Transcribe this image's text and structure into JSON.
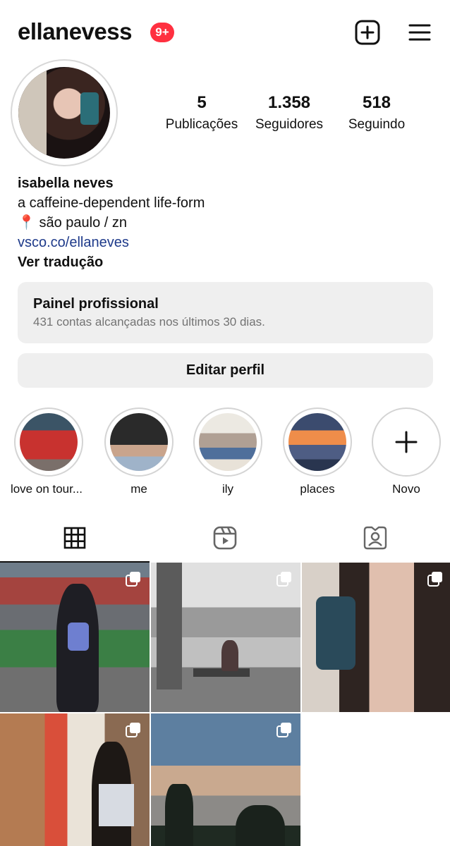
{
  "header": {
    "username": "ellanevess",
    "notification_badge": "9+",
    "icons": [
      "add-post-icon",
      "hamburger-menu-icon"
    ]
  },
  "profile": {
    "stats": [
      {
        "value": "5",
        "label": "Publicações"
      },
      {
        "value": "1.358",
        "label": "Seguidores"
      },
      {
        "value": "518",
        "label": "Seguindo"
      }
    ],
    "name": "isabella neves",
    "bio_line": "a caffeine-dependent life-form",
    "location_pin": "📍",
    "location": "são paulo / zn",
    "link": "vsco.co/ellaneves",
    "translate": "Ver tradução"
  },
  "professional_panel": {
    "title": "Painel profissional",
    "subtitle": "431 contas alcançadas nos últimos 30 dias."
  },
  "edit_profile_label": "Editar perfil",
  "highlights": [
    {
      "label": "love on tour..."
    },
    {
      "label": "me"
    },
    {
      "label": "ily"
    },
    {
      "label": "places"
    },
    {
      "label": "Novo"
    }
  ],
  "tabs": [
    "grid-icon",
    "reels-icon",
    "tagged-icon"
  ],
  "active_tab": "grid",
  "posts_count_visible": 5,
  "colors": {
    "badge": "#ff3040",
    "link": "#1e3a8a",
    "panel_bg": "#efefef",
    "muted": "#737373"
  }
}
